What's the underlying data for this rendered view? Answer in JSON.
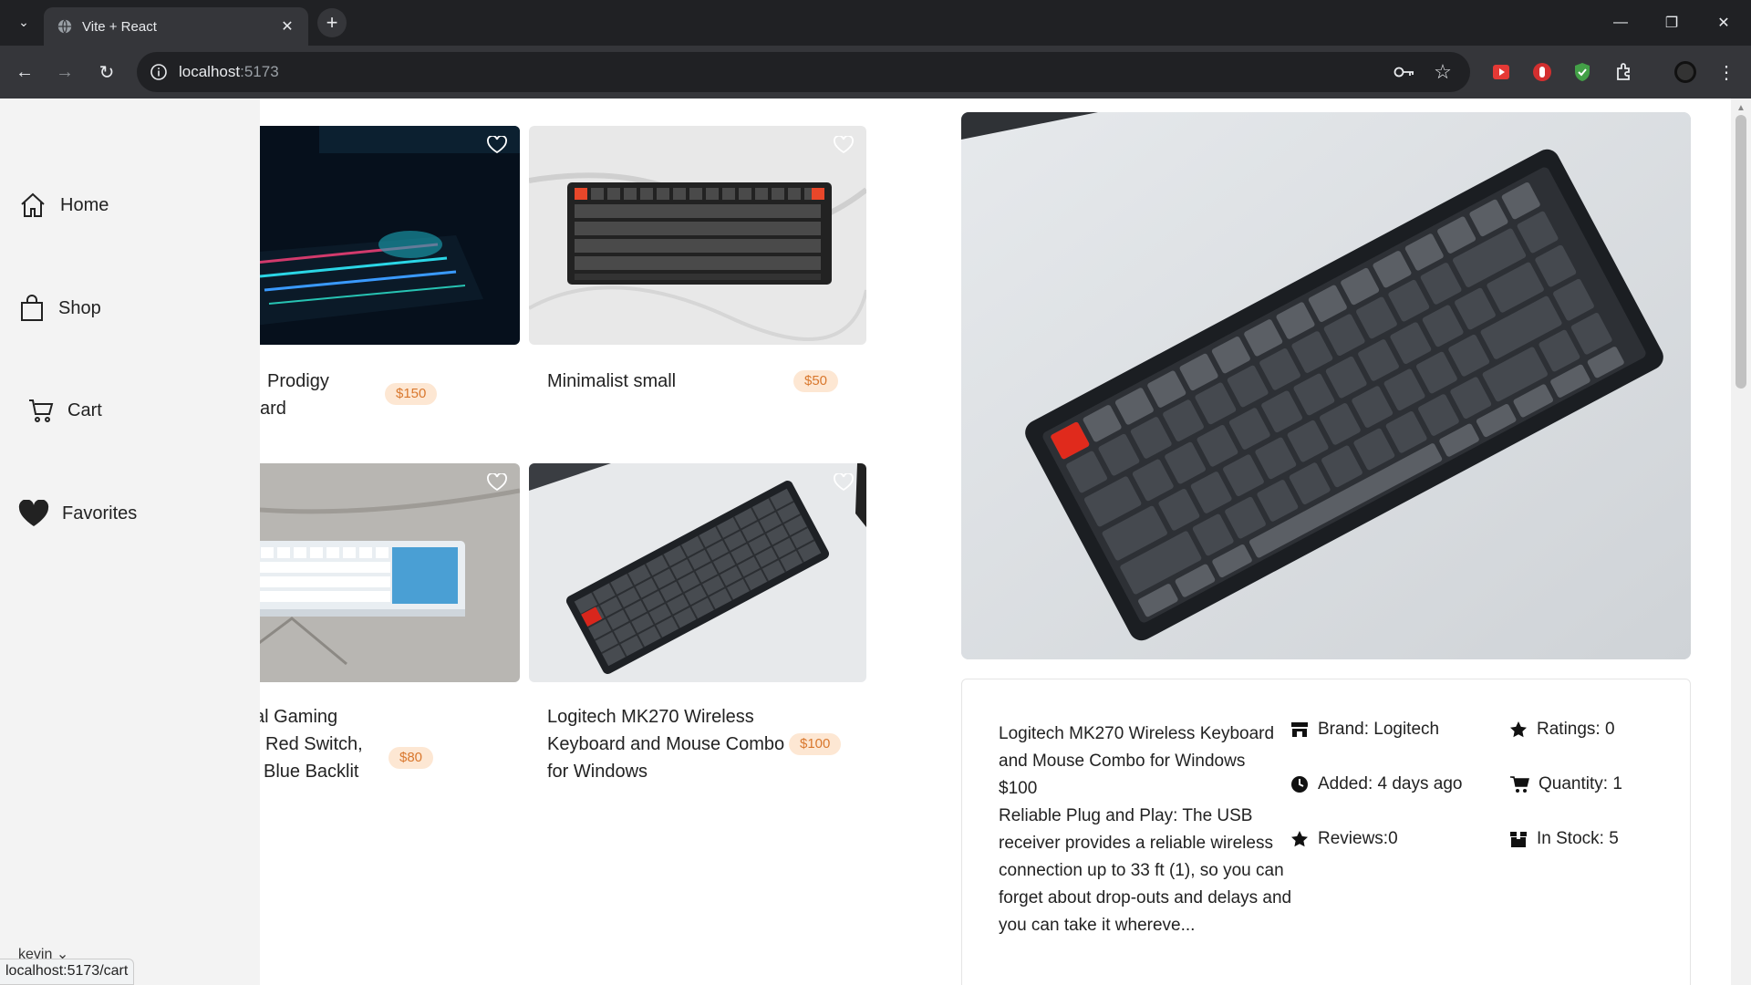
{
  "browser": {
    "tab_title": "Vite + React",
    "url_host": "localhost",
    "url_port": ":5173",
    "status_url": "localhost:5173/cart"
  },
  "sidebar": {
    "items": [
      {
        "label": "Home",
        "icon": "home-icon"
      },
      {
        "label": "Shop",
        "icon": "shopping-bag-icon"
      },
      {
        "label": "Cart",
        "icon": "cart-icon"
      },
      {
        "label": "Favorites",
        "icon": "heart-filled-icon"
      }
    ],
    "user": "kevin"
  },
  "products": [
    {
      "title_line1": "Prodigy",
      "title_line2": "ard",
      "price": "$150"
    },
    {
      "title_line1": "Minimalist small",
      "price": "$50"
    },
    {
      "title_line1": "al Gaming",
      "title_line2": "Red Switch,",
      "title_line3": "Blue Backlit",
      "price": "$80"
    },
    {
      "title_line1": "Logitech MK270 Wireless",
      "title_line2": "Keyboard and Mouse Combo",
      "title_line3": "for Windows",
      "price": "$100"
    }
  ],
  "detail": {
    "title_line1": "Logitech MK270 Wireless Keyboard",
    "title_line2": "and Mouse Combo for Windows",
    "price": "$100",
    "description": "Reliable Plug and Play: The USB receiver provides a reliable wireless connection up to 33 ft (1), so you can forget about drop-outs and delays and you can take it whereve...",
    "brand": "Brand: Logitech",
    "added": "Added: 4 days ago",
    "reviews": "Reviews:0",
    "ratings": "Ratings: 0",
    "quantity": "Quantity: 1",
    "stock": "In Stock: 5"
  },
  "colors": {
    "price_bg": "#fde7d3",
    "price_text": "#d9782e",
    "sidebar_bg": "#f3f3f3"
  }
}
